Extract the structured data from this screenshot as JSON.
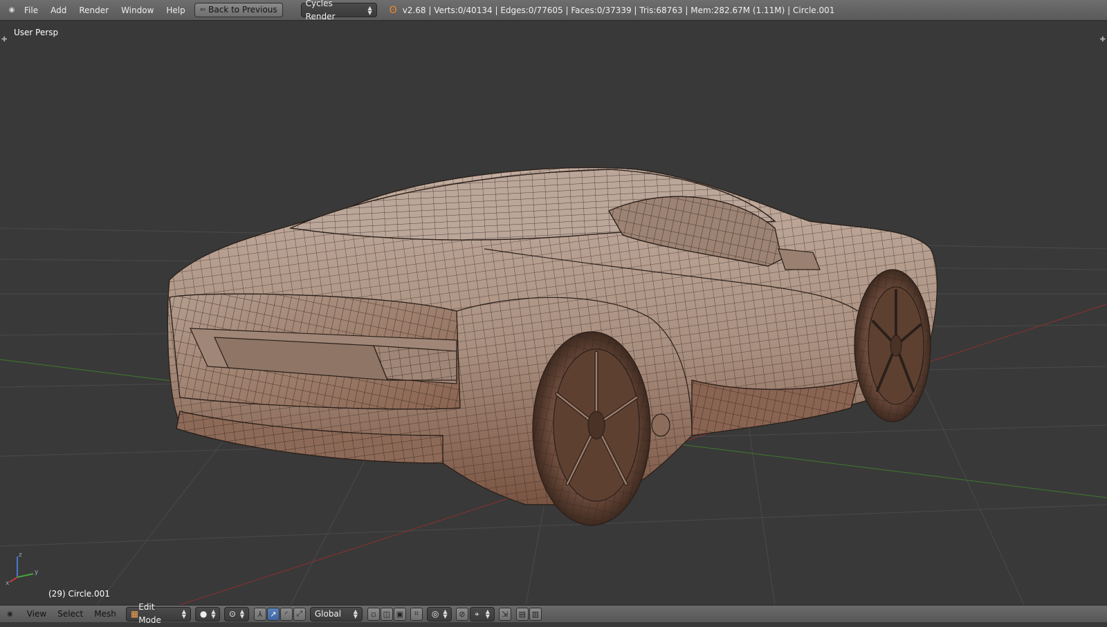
{
  "top": {
    "menus": [
      "File",
      "Add",
      "Render",
      "Window",
      "Help"
    ],
    "back_button": "Back to Previous",
    "render_engine": "Cycles Render",
    "stats": "v2.68 | Verts:0/40134 | Edges:0/77605 | Faces:0/37339 | Tris:68763 | Mem:282.67M (1.11M) | Circle.001"
  },
  "viewport": {
    "view_label": "User Persp",
    "object_label": "(29) Circle.001",
    "axis": {
      "x": "x",
      "y": "y",
      "z": "z"
    }
  },
  "bottom": {
    "menus": [
      "View",
      "Select",
      "Mesh"
    ],
    "mode": "Edit Mode",
    "orientation": "Global"
  },
  "colors": {
    "background": "#393939",
    "grid": "#4a4a4a",
    "x_axis": "#8c3030",
    "y_axis": "#3f7a2b",
    "mesh_fill": "#a88e7e",
    "mesh_wire": "#2b201a",
    "active_blue": "#4a72ae"
  },
  "icons": [
    "editor-type-icon",
    "back-icon",
    "blender-logo-icon",
    "mode-icon",
    "shading-sphere-icon",
    "pivot-icon",
    "manipulator-icon",
    "translate-icon",
    "rotate-icon",
    "scale-icon",
    "vertex-select-icon",
    "edge-select-icon",
    "face-select-icon",
    "occlude-icon",
    "proportional-icon",
    "snap-icon",
    "snap-target-icon",
    "opengl-render-icon",
    "opengl-anim-icon"
  ]
}
